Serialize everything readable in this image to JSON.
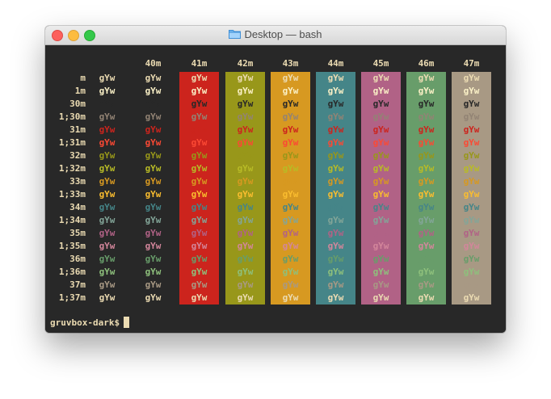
{
  "window": {
    "title": "Desktop — bash",
    "folder_icon": "folder-icon"
  },
  "terminal": {
    "bg": "#282828",
    "fg": "#ebdbb2",
    "sample": "gYw",
    "columns": [
      "",
      "",
      "40m",
      "41m",
      "42m",
      "43m",
      "44m",
      "45m",
      "46m",
      "47m"
    ],
    "column_bgs": [
      null,
      null,
      null,
      "#cc241d",
      "#98971a",
      "#d79921",
      "#458588",
      "#b16286",
      "#689d6a",
      "#a89984"
    ],
    "rows": [
      {
        "label": "m",
        "colors": [
          "#ebdbb2",
          "#ebdbb2",
          "#ebdbb2",
          "#ebdbb2",
          "#ebdbb2",
          "#ebdbb2",
          "#ebdbb2",
          "#ebdbb2",
          "#ebdbb2"
        ]
      },
      {
        "label": "1m",
        "colors": [
          "#fbf1c7",
          "#fbf1c7",
          "#fbf1c7",
          "#fbf1c7",
          "#fbf1c7",
          "#fbf1c7",
          "#fbf1c7",
          "#fbf1c7",
          "#fbf1c7"
        ]
      },
      {
        "label": "30m",
        "colors": [
          "#282828",
          "#282828",
          "#282828",
          "#282828",
          "#282828",
          "#282828",
          "#282828",
          "#282828",
          "#282828"
        ]
      },
      {
        "label": "1;30m",
        "colors": [
          "#928374",
          "#928374",
          "#928374",
          "#928374",
          "#928374",
          "#928374",
          "#928374",
          "#928374",
          "#928374"
        ]
      },
      {
        "label": "31m",
        "colors": [
          "#cc241d",
          "#cc241d",
          "#cc241d",
          "#cc241d",
          "#cc241d",
          "#cc241d",
          "#cc241d",
          "#cc241d",
          "#cc241d"
        ]
      },
      {
        "label": "1;31m",
        "colors": [
          "#fb4934",
          "#fb4934",
          "#fb4934",
          "#fb4934",
          "#fb4934",
          "#fb4934",
          "#fb4934",
          "#fb4934",
          "#fb4934"
        ]
      },
      {
        "label": "32m",
        "colors": [
          "#98971a",
          "#98971a",
          "#98971a",
          "#98971a",
          "#98971a",
          "#98971a",
          "#98971a",
          "#98971a",
          "#98971a"
        ]
      },
      {
        "label": "1;32m",
        "colors": [
          "#b8bb26",
          "#b8bb26",
          "#b8bb26",
          "#b8bb26",
          "#b8bb26",
          "#b8bb26",
          "#b8bb26",
          "#b8bb26",
          "#b8bb26"
        ]
      },
      {
        "label": "33m",
        "colors": [
          "#d79921",
          "#d79921",
          "#d79921",
          "#d79921",
          "#d79921",
          "#d79921",
          "#d79921",
          "#d79921",
          "#d79921"
        ]
      },
      {
        "label": "1;33m",
        "colors": [
          "#fabd2f",
          "#fabd2f",
          "#fabd2f",
          "#fabd2f",
          "#fabd2f",
          "#fabd2f",
          "#fabd2f",
          "#fabd2f",
          "#fabd2f"
        ]
      },
      {
        "label": "34m",
        "colors": [
          "#458588",
          "#458588",
          "#458588",
          "#458588",
          "#458588",
          "#458588",
          "#458588",
          "#458588",
          "#458588"
        ]
      },
      {
        "label": "1;34m",
        "colors": [
          "#83a598",
          "#83a598",
          "#83a598",
          "#83a598",
          "#83a598",
          "#83a598",
          "#83a598",
          "#83a598",
          "#83a598"
        ]
      },
      {
        "label": "35m",
        "colors": [
          "#b16286",
          "#b16286",
          "#b16286",
          "#b16286",
          "#b16286",
          "#b16286",
          "#b16286",
          "#b16286",
          "#b16286"
        ]
      },
      {
        "label": "1;35m",
        "colors": [
          "#d3869b",
          "#d3869b",
          "#d3869b",
          "#d3869b",
          "#d3869b",
          "#d3869b",
          "#d3869b",
          "#d3869b",
          "#d3869b"
        ]
      },
      {
        "label": "36m",
        "colors": [
          "#689d6a",
          "#689d6a",
          "#689d6a",
          "#689d6a",
          "#689d6a",
          "#689d6a",
          "#689d6a",
          "#689d6a",
          "#689d6a"
        ]
      },
      {
        "label": "1;36m",
        "colors": [
          "#8ec07c",
          "#8ec07c",
          "#8ec07c",
          "#8ec07c",
          "#8ec07c",
          "#8ec07c",
          "#8ec07c",
          "#8ec07c",
          "#8ec07c"
        ]
      },
      {
        "label": "37m",
        "colors": [
          "#a89984",
          "#a89984",
          "#a89984",
          "#a89984",
          "#a89984",
          "#a89984",
          "#a89984",
          "#a89984",
          "#a89984"
        ]
      },
      {
        "label": "1;37m",
        "colors": [
          "#ebdbb2",
          "#ebdbb2",
          "#ebdbb2",
          "#ebdbb2",
          "#ebdbb2",
          "#ebdbb2",
          "#ebdbb2",
          "#ebdbb2",
          "#ebdbb2"
        ]
      }
    ],
    "prompt": "gruvbox-dark$"
  }
}
